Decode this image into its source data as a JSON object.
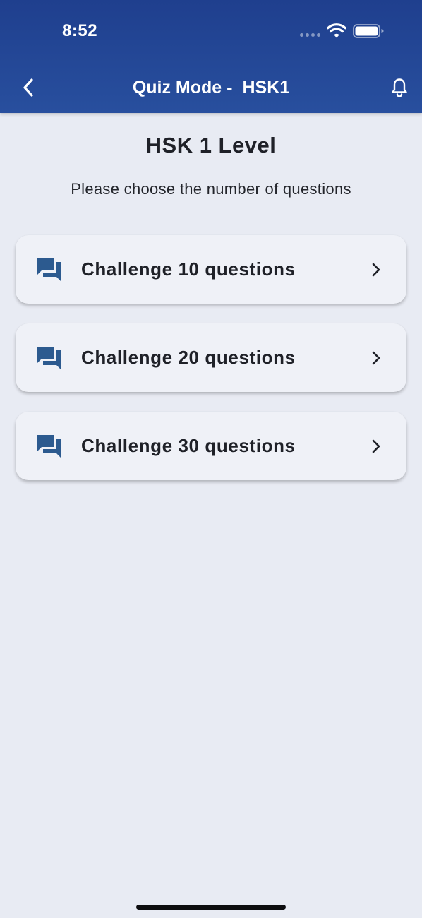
{
  "status_bar": {
    "time": "8:52"
  },
  "app_bar": {
    "title_prefix": "Quiz Mode -",
    "title_level": "HSK1"
  },
  "page": {
    "title": "HSK 1 Level",
    "subtitle": "Please choose the number of questions"
  },
  "options": [
    {
      "label": "Challenge 10 questions",
      "icon": "chat-icon"
    },
    {
      "label": "Challenge 20 questions",
      "icon": "chat-icon"
    },
    {
      "label": "Challenge 30 questions",
      "icon": "chat-icon"
    }
  ],
  "colors": {
    "header_top": "#1f3f8e",
    "header_bottom": "#284f9e",
    "background": "#e8ebf3",
    "card": "#eff1f7",
    "icon_accent": "#2c5a8f",
    "text_primary": "#1f2128"
  }
}
